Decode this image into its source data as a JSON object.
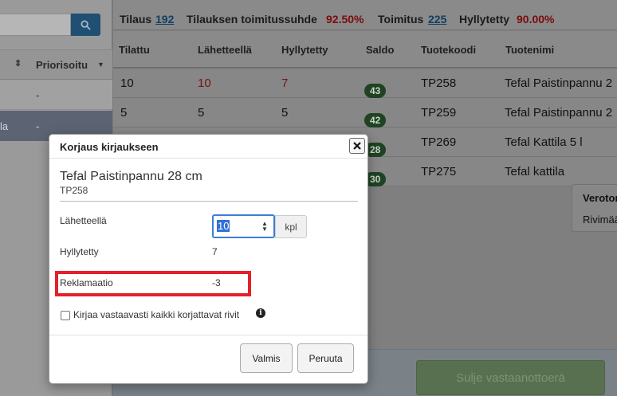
{
  "sidebar": {
    "priority_header": "Priorisoitu",
    "rows": [
      {
        "prefix": "",
        "value": "-"
      },
      {
        "prefix": "la",
        "value": "-"
      }
    ]
  },
  "summary": {
    "order_label": "Tilaus",
    "order_value": "192",
    "ratio_label": "Tilauksen toimitussuhde",
    "ratio_value": "92.50%",
    "delivery_label": "Toimitus",
    "delivery_value": "225",
    "shelved_label": "Hyllytetty",
    "shelved_value": "90.00%"
  },
  "table": {
    "columns": [
      "Tilattu",
      "Lähetteellä",
      "Hyllytetty",
      "Saldo",
      "Tuotekoodi",
      "Tuotenimi"
    ],
    "rows": [
      {
        "ordered": "10",
        "on_note": "10",
        "shelved": "7",
        "balance": "43",
        "code": "TP258",
        "name": "Tefal Paistinpannu 2"
      },
      {
        "ordered": "5",
        "on_note": "5",
        "shelved": "5",
        "balance": "42",
        "code": "TP259",
        "name": "Tefal Paistinpannu 2"
      },
      {
        "ordered": "",
        "on_note": "",
        "shelved": "",
        "balance": "28",
        "code": "TP269",
        "name": "Tefal Kattila 5 l"
      },
      {
        "ordered": "",
        "on_note": "",
        "shelved": "",
        "balance": "30",
        "code": "TP275",
        "name": "Tefal kattila"
      }
    ]
  },
  "side_box": {
    "line1": "Veroton",
    "line2": "Rivimää"
  },
  "bottom": {
    "close_label": "Sulje vastaanottoerä"
  },
  "modal": {
    "title": "Korjaus kirjaukseen",
    "product_name": "Tefal Paistinpannu 28 cm",
    "product_code": "TP258",
    "on_note_label": "Lähetteellä",
    "on_note_value": "10",
    "unit": "kpl",
    "shelved_label": "Hyllytetty",
    "shelved_value": "7",
    "claim_label": "Reklamaatio",
    "claim_value": "-3",
    "checkbox_label": "Kirjaa vastaavasti kaikki korjattavat rivit",
    "ok_label": "Valmis",
    "cancel_label": "Peruuta"
  },
  "colors": {
    "accent": "#3d7ed6",
    "highlight": "#e4202a",
    "badge": "#2e6b34"
  }
}
